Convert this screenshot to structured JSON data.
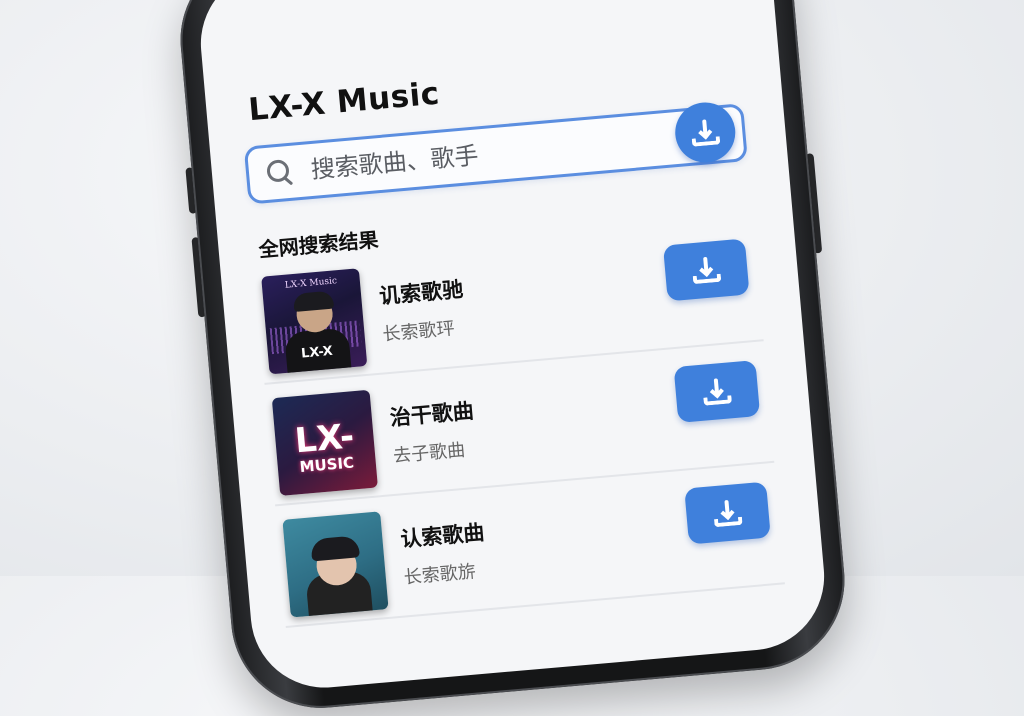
{
  "app": {
    "title": "LX-X Music"
  },
  "search": {
    "placeholder": "搜索歌曲、歌手"
  },
  "section": {
    "title": "全网搜索结果"
  },
  "songs": [
    {
      "title": "讥索歌驰",
      "artist": "长索歌玶",
      "cover_caption": "LX‑X Music",
      "cover_text": "LX-X"
    },
    {
      "title": "治干歌曲",
      "artist": "去子歌曲",
      "cover_text": "LX-",
      "cover_text2": "MUSIC"
    },
    {
      "title": "认索歌曲",
      "artist": "长索歌旂"
    }
  ],
  "colors": {
    "accent": "#3f80dc",
    "search_border": "#5b8ee0"
  },
  "icons": {
    "search": "search-icon",
    "download": "download-icon"
  }
}
